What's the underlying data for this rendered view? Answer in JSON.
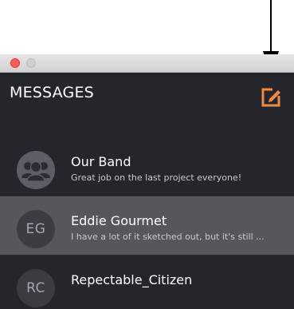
{
  "window": {
    "title": "MESSAGES",
    "accent_color": "#f08a3c",
    "compose_icon": "compose-icon"
  },
  "conversations": [
    {
      "name": "Our Band",
      "preview": "Great job on the last project everyone!",
      "avatar_icon": "group-icon",
      "selected": false
    },
    {
      "name": "Eddie Gourmet",
      "preview": "I have a lot of it sketched out, but it's still ...",
      "initials": "EG",
      "selected": true
    },
    {
      "name": "Repectable_Citizen",
      "preview": "",
      "initials": "RC",
      "selected": false
    }
  ]
}
